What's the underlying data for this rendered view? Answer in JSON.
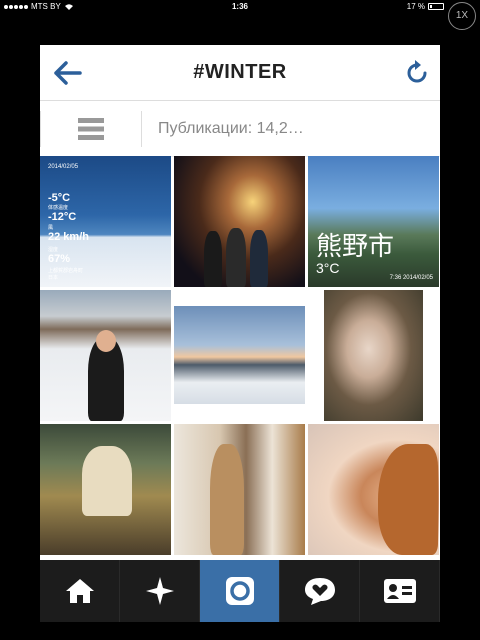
{
  "status_bar": {
    "carrier": "MTS BY",
    "time": "1:36",
    "battery": "17 %",
    "battery_level": 0.17,
    "zoom_label": "1X"
  },
  "nav": {
    "title": "#WINTER",
    "back_icon": "back-arrow-icon",
    "refresh_icon": "refresh-icon"
  },
  "view_tabs": {
    "grid_icon": "grid-view-icon",
    "list_icon": "list-view-icon",
    "publications_label": "Публикации: 14,2…"
  },
  "photos": [
    {
      "name": "weather-widget-photo",
      "overlay": {
        "date": "2014/02/05",
        "temp1": "-5°C",
        "sub1": "体感温度",
        "temp2": "-12°C",
        "sub2": "風",
        "wind": "22 km/h",
        "sub3": "湿度",
        "humidity": "67%",
        "place": "上都賀郡岩舟町",
        "country": "日本"
      }
    },
    {
      "name": "night-cabin-group-photo"
    },
    {
      "name": "mountain-town-photo",
      "overlay": {
        "kanji": "熊野市",
        "temp": "3°C",
        "stamp": "7:36 2014/02/05"
      }
    },
    {
      "name": "snow-mountain-woman-photo"
    },
    {
      "name": "frozen-lake-photo"
    },
    {
      "name": "woman-selfie-photo"
    },
    {
      "name": "dog-costume-photo"
    },
    {
      "name": "mirror-selfie-photo"
    },
    {
      "name": "woman-in-bed-photo"
    }
  ],
  "tabbar": [
    {
      "name": "home-tab",
      "icon": "home-icon",
      "active": false
    },
    {
      "name": "explore-tab",
      "icon": "star-icon",
      "active": false
    },
    {
      "name": "camera-tab",
      "icon": "camera-icon",
      "active": true
    },
    {
      "name": "activity-tab",
      "icon": "heart-bubble-icon",
      "active": false
    },
    {
      "name": "profile-tab",
      "icon": "profile-card-icon",
      "active": false
    }
  ],
  "colors": {
    "accent": "#3a6fa7",
    "nav_icon": "#2c5f9a"
  }
}
